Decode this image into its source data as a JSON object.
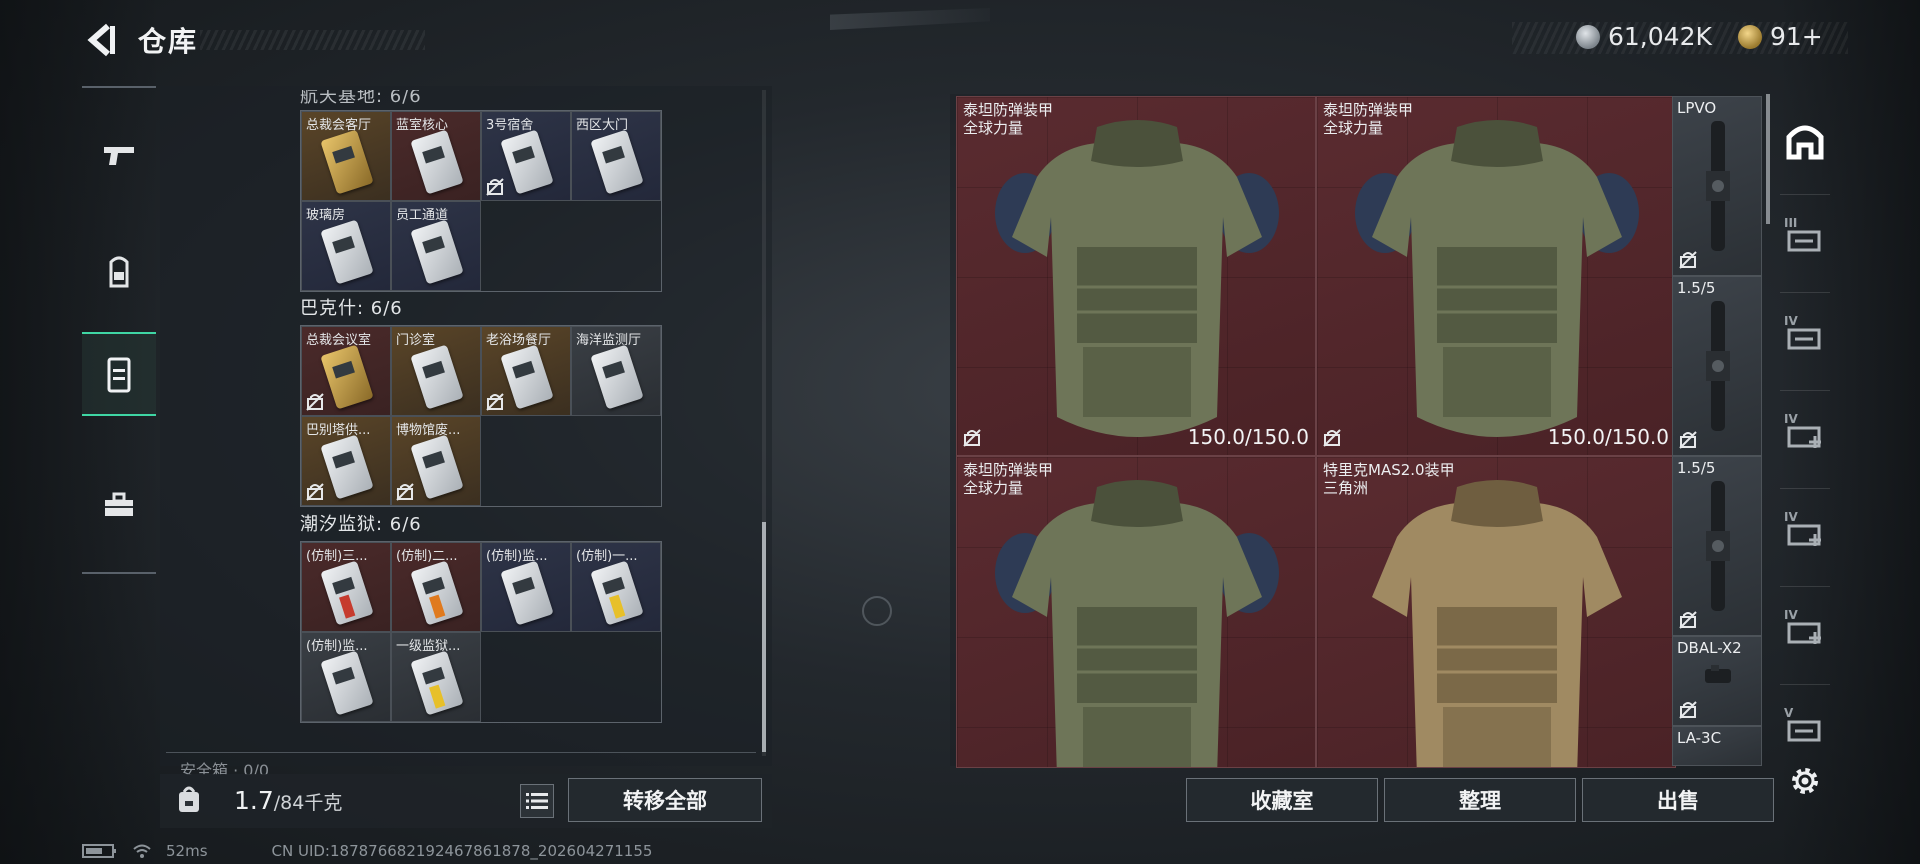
{
  "header": {
    "title": "仓库",
    "currencies": [
      {
        "icon": "silver-coin-icon",
        "value": "61,042K"
      },
      {
        "icon": "gold-coin-icon",
        "value": "91+"
      }
    ]
  },
  "left_tabs": [
    {
      "icon": "pistol-icon",
      "active": false
    },
    {
      "icon": "backpack-icon",
      "active": false
    },
    {
      "icon": "safe-box-icon",
      "active": true
    },
    {
      "icon": "toolbox-icon",
      "active": false
    }
  ],
  "container": {
    "partial_header": "航天基地: 6/6",
    "sections": [
      {
        "title": "",
        "cards": [
          {
            "label": "总裁会客厅",
            "tint": "gold",
            "card": "gold",
            "locked": false
          },
          {
            "label": "蓝室核心",
            "tint": "red",
            "card": "white",
            "locked": false
          },
          {
            "label": "3号宿舍",
            "tint": "blue",
            "card": "white",
            "locked": true
          },
          {
            "label": "西区大门",
            "tint": "blue",
            "card": "white",
            "locked": false
          },
          {
            "label": "玻璃房",
            "tint": "blue",
            "card": "white",
            "locked": false
          },
          {
            "label": "员工通道",
            "tint": "blue",
            "card": "white",
            "locked": false
          }
        ]
      },
      {
        "title": "巴克什: 6/6",
        "cards": [
          {
            "label": "总裁会议室",
            "tint": "red",
            "card": "gold",
            "locked": true
          },
          {
            "label": "门诊室",
            "tint": "gold",
            "card": "white",
            "locked": false
          },
          {
            "label": "老浴场餐厅",
            "tint": "gold",
            "card": "white",
            "locked": true
          },
          {
            "label": "海洋监测厅",
            "tint": "gray",
            "card": "white",
            "locked": false
          },
          {
            "label": "巴别塔供...",
            "tint": "gold",
            "card": "white",
            "locked": true
          },
          {
            "label": "博物馆废...",
            "tint": "gold",
            "card": "white",
            "locked": true
          }
        ]
      },
      {
        "title": "潮汐监狱: 6/6",
        "cards": [
          {
            "label": "(仿制)三...",
            "tint": "red",
            "card": "red",
            "locked": false
          },
          {
            "label": "(仿制)二...",
            "tint": "red",
            "card": "orange",
            "locked": false
          },
          {
            "label": "(仿制)监...",
            "tint": "blue",
            "card": "white",
            "locked": false
          },
          {
            "label": "(仿制)一...",
            "tint": "blue",
            "card": "yellow",
            "locked": false
          },
          {
            "label": "(仿制)监...",
            "tint": "gray",
            "card": "white",
            "locked": false
          },
          {
            "label": "一级监狱...",
            "tint": "gray",
            "card": "yellow",
            "locked": false
          }
        ]
      }
    ],
    "bottom_partial": "安全箱 · 0/0"
  },
  "weight": {
    "current": "1.7",
    "capacity": "/84千克"
  },
  "transfer_all": "转移全部",
  "status": {
    "ping": "52ms",
    "uid": "CN UID:1878766821924678​61878_202604271155"
  },
  "stash": {
    "armors": [
      {
        "name": "泰坦防弹装甲",
        "sub": "全球力量",
        "durability": "150.0/150.0",
        "style": "green",
        "locked": true
      },
      {
        "name": "泰坦防弹装甲",
        "sub": "全球力量",
        "durability": "150.0/150.0",
        "style": "green",
        "locked": true
      },
      {
        "name": "泰坦防弹装甲",
        "sub": "全球力量",
        "durability": "",
        "style": "green",
        "locked": false
      },
      {
        "name": "特里克MAS2.0装甲",
        "sub": "三角洲",
        "durability": "",
        "style": "camo",
        "locked": false
      }
    ],
    "attachments": [
      {
        "name": "LPVO",
        "locked": true
      },
      {
        "name": "1.5/5",
        "locked": true
      },
      {
        "name": "1.5/5",
        "locked": true
      },
      {
        "name": "DBAL-X2",
        "locked": true
      },
      {
        "name": "LA-3C",
        "locked": false
      }
    ],
    "buttons": {
      "collection": "收藏室",
      "sort": "整理",
      "sell": "出售"
    }
  },
  "right_tabs": [
    {
      "icon": "stash-home-icon",
      "roman": ""
    },
    {
      "icon": "stash-tab-icon",
      "roman": "III"
    },
    {
      "icon": "stash-tab-icon",
      "roman": "IV"
    },
    {
      "icon": "stash-add-icon",
      "roman": "IV"
    },
    {
      "icon": "stash-add-icon",
      "roman": "IV"
    },
    {
      "icon": "stash-add-icon",
      "roman": "IV"
    },
    {
      "icon": "stash-image-icon",
      "roman": "V"
    }
  ],
  "colors": {
    "accent": "#3fd6a4",
    "armor_bg": "#5a2b30",
    "panel_bg": "#1c2126"
  }
}
